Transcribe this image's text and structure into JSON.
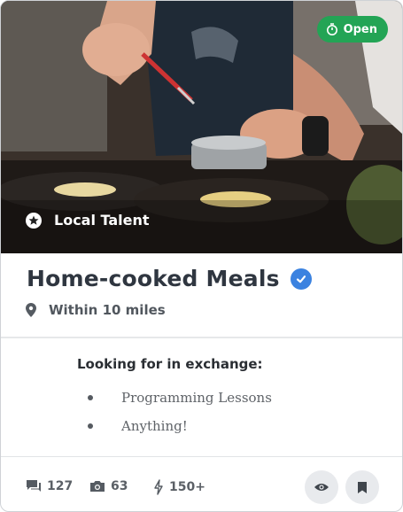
{
  "card": {
    "status_badge": "Open",
    "hero_icon": "star-icon",
    "hero_label": "Local Talent",
    "title": "Home-cooked Meals",
    "verified_icon": "check-badge-icon",
    "location_icon": "map-pin-icon",
    "location": "Within 10 miles",
    "exchange_title": "Looking for in exchange:",
    "exchange_items": [
      "Programming Lessons",
      "Anything!"
    ],
    "stats": [
      {
        "icon": "comment-icon",
        "value": "127"
      },
      {
        "icon": "camera-icon",
        "value": "63"
      },
      {
        "icon": "lightning-icon",
        "value": "150+"
      }
    ],
    "actions": [
      {
        "icon": "eye-icon"
      },
      {
        "icon": "bookmark-icon"
      }
    ]
  },
  "colors": {
    "open_badge": "#23a455",
    "verified": "#3b82e0",
    "title": "#2f3640"
  }
}
